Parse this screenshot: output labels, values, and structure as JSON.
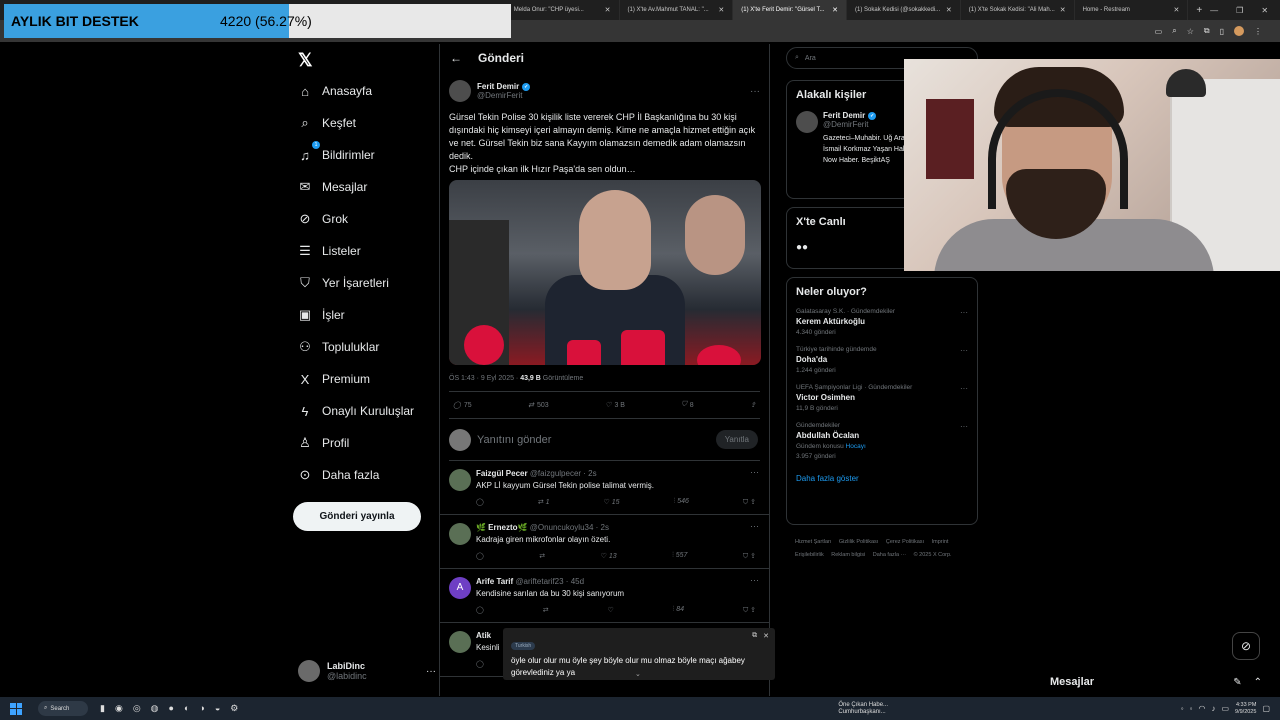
{
  "donation": {
    "label": "AYLIK BIT DESTEK",
    "amount": "4220 (56.27%)",
    "progress": 0.5627
  },
  "browser": {
    "tabs": [
      {
        "label": "Melda Onur: \"CHP üyesi...",
        "active": false
      },
      {
        "label": "(1) X'te Av.Mahmut TANAL: \"...",
        "active": false
      },
      {
        "label": "(1) X'te Ferit Demir: \"Gürsel T...",
        "active": true
      },
      {
        "label": "(1) Sokak Kedisi (@sokakkedi...",
        "active": false
      },
      {
        "label": "(1) X'te Sokak Kedisi: \"Ali Mah...",
        "active": false
      },
      {
        "label": "Home - Restream",
        "active": false
      }
    ]
  },
  "nav": {
    "items": [
      {
        "label": "Anasayfa",
        "icon": "home-icon",
        "glyph": "⌂"
      },
      {
        "label": "Keşfet",
        "icon": "search-icon",
        "glyph": "⌕"
      },
      {
        "label": "Bildirimler",
        "icon": "bell-icon",
        "glyph": "♫",
        "badge": "1"
      },
      {
        "label": "Mesajlar",
        "icon": "mail-icon",
        "glyph": "✉"
      },
      {
        "label": "Grok",
        "icon": "grok-icon",
        "glyph": "⊘"
      },
      {
        "label": "Listeler",
        "icon": "list-icon",
        "glyph": "☰"
      },
      {
        "label": "Yer İşaretleri",
        "icon": "bookmark-icon",
        "glyph": "⛉"
      },
      {
        "label": "İşler",
        "icon": "briefcase-icon",
        "glyph": "▣"
      },
      {
        "label": "Topluluklar",
        "icon": "communities-icon",
        "glyph": "⚇"
      },
      {
        "label": "Premium",
        "icon": "x-premium-icon",
        "glyph": "X"
      },
      {
        "label": "Onaylı Kuruluşlar",
        "icon": "lightning-icon",
        "glyph": "ϟ"
      },
      {
        "label": "Profil",
        "icon": "profile-icon",
        "glyph": "♙"
      },
      {
        "label": "Daha fazla",
        "icon": "more-circle-icon",
        "glyph": "⊙"
      }
    ],
    "post_button": "Gönderi yayınla",
    "account": {
      "name": "LabiDinc",
      "handle": "@labidinc"
    }
  },
  "header": {
    "title": "Gönderi"
  },
  "tweet": {
    "author": "Ferit Demir",
    "handle": "@DemirFerit",
    "text": "Gürsel Tekin Polise 30 kişilik liste vererek CHP İl Başkanlığına bu 30 kişi dışındaki hiç kimseyi içeri almayın demiş. Kime ne amaçla hizmet ettiğin açık ve net. Gürsel Tekin biz sana Kayyım olamazsın demedik adam olamazsın dedik.\nCHP içinde çıkan ilk Hızır Paşa'da sen oldun…",
    "time": "ÖS 1:43 · 9 Eyl 2025 · ",
    "views": "43,9 B",
    "views_label": " Görüntüleme",
    "replies": "75",
    "reposts": "503",
    "likes": "3 B",
    "bookmarks": "8"
  },
  "compose": {
    "placeholder": "Yanıtını gönder",
    "button": "Yanıtla"
  },
  "replies": [
    {
      "name": "Faizgül Pecer",
      "handle": "@faizgulpecer · 2s",
      "text": "AKP Lİ kayyum Gürsel Tekin polise talimat vermiş.",
      "retweets": "1",
      "likes": "15",
      "views": "546",
      "avatar": ""
    },
    {
      "name": "🌿 Ernezto🌿",
      "handle": "@Onuncukoylu34 · 2s",
      "text": "Kadraja giren mikrofonlar olayın özeti.",
      "retweets": "",
      "likes": "13",
      "views": "557",
      "avatar": ""
    },
    {
      "name": "Arife Tarif",
      "handle": "@ariftetarif23 · 45d",
      "text": "Kendisine sarılan da bu 30 kişi sanıyorum",
      "retweets": "",
      "likes": "",
      "views": "84",
      "avatar": "A"
    },
    {
      "name": "Atik",
      "handle": "",
      "text": "Kesinli",
      "retweets": "",
      "likes": "",
      "views": "",
      "avatar": ""
    }
  ],
  "caption": {
    "lang": "Turkish",
    "text": "öyle olur olur mu öyle şey böyle olur mu olmaz böyle maçı ağabey görevlediniz ya ya"
  },
  "right": {
    "search_placeholder": "Ara",
    "related_title": "Alakalı kişiler",
    "related": {
      "name": "Ferit Demir",
      "handle": "@DemirFerit",
      "bio": "Gazeteci–Muhabir. Uğ Araştırmacı Gazetecil İsmail Korkmaz Yaşan Haber Ödülü. Basın Ö Now Haber. BeşiktAŞ"
    },
    "live_title": "X'te Canlı",
    "trends_title": "Neler oluyor?",
    "trends": [
      {
        "context": "Galatasaray S.K. · Gündemdekiler",
        "title": "Kerem Aktürkoğlu",
        "count": "4.340 gönderi",
        "link": ""
      },
      {
        "context": "Türkiye tarihinde gündemde",
        "title": "Doha'da",
        "count": "1.244 gönderi",
        "link": ""
      },
      {
        "context": "UEFA Şampiyonlar Ligi · Gündemdekiler",
        "title": "Victor Osimhen",
        "count": "11,9 B gönderi",
        "link": ""
      },
      {
        "context": "Gündemdekiler",
        "title": "Abdullah Öcalan",
        "count": "Gündem konusu ",
        "link": "Hocayı",
        "count2": "3.957 gönderi"
      }
    ],
    "show_more": "Daha fazla göster",
    "footer": [
      "Hizmet Şartları",
      "Gizlilik Politikası",
      "Çerez Politikası",
      "Imprint",
      "Erişilebilirlik",
      "Reklam bilgisi",
      "Daha fazla ···",
      "© 2025 X Corp."
    ]
  },
  "messages_drawer": {
    "title": "Mesajlar"
  },
  "taskbar": {
    "search": "Search",
    "news_title": "Öne Çıkan Habe...",
    "news_sub": "Cumhurbaşkanı...",
    "time": "4:33 PM",
    "date": "9/9/2025"
  }
}
